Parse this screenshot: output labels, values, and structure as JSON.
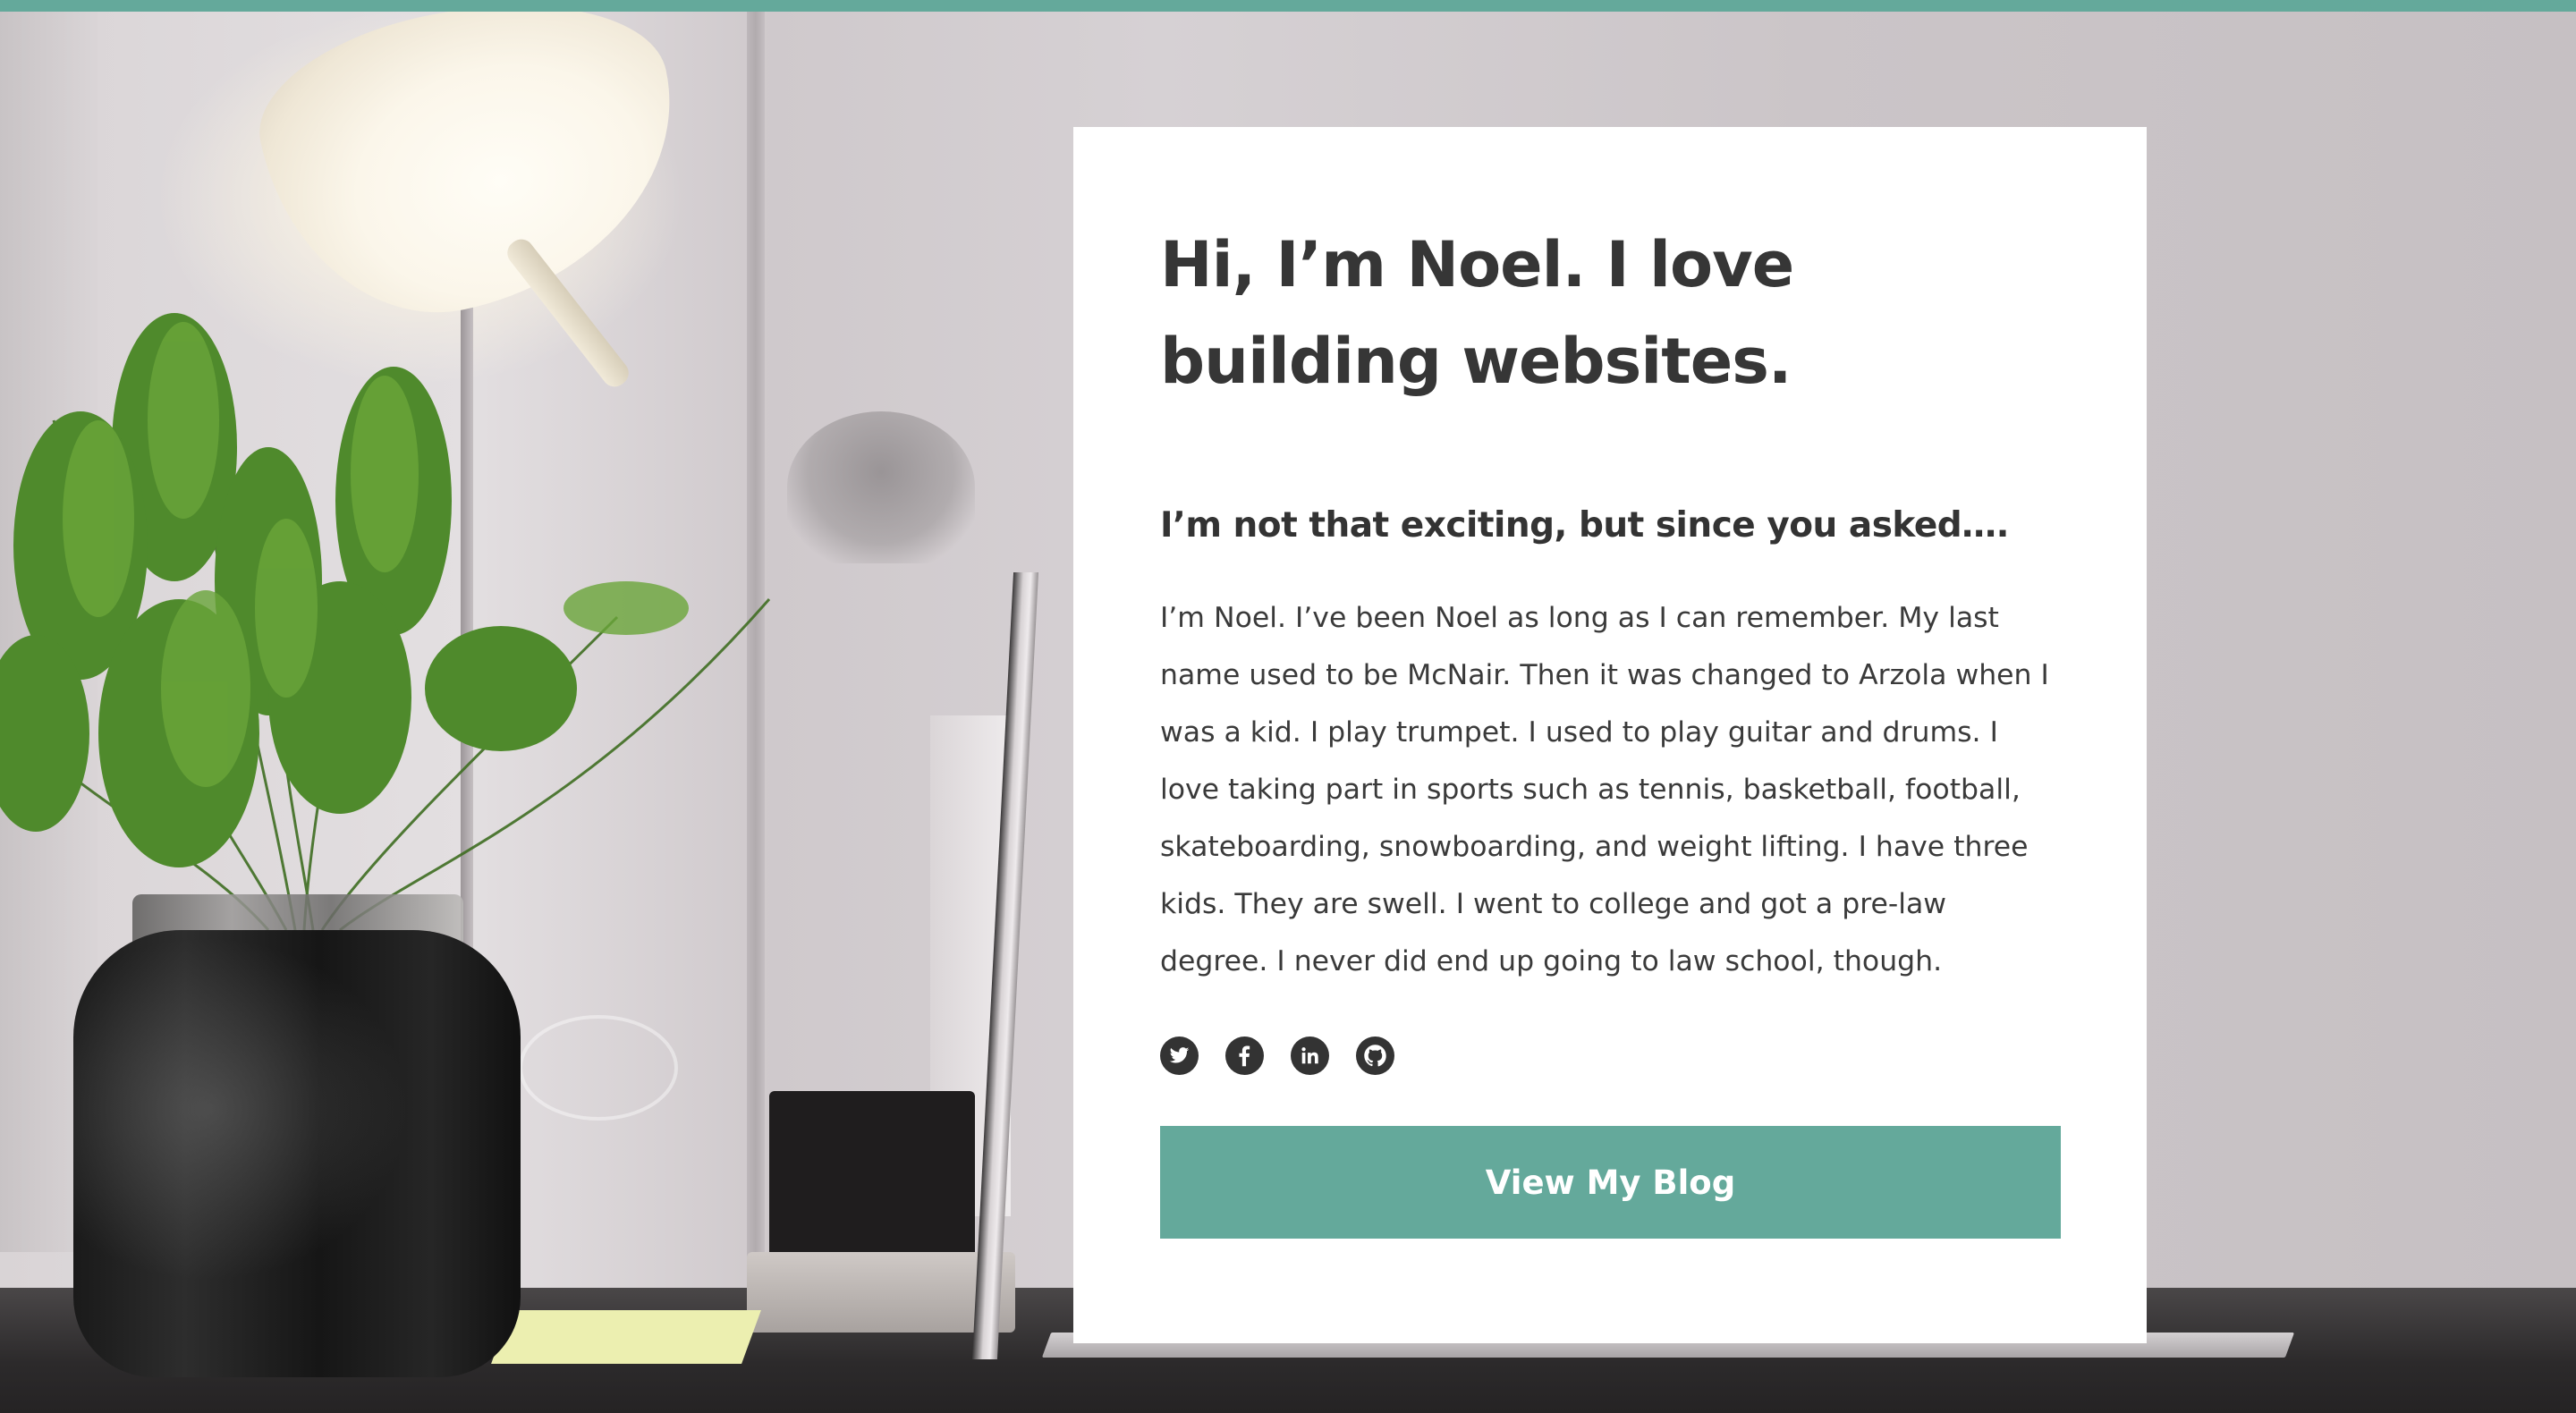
{
  "theme": {
    "accent": "#64a99b",
    "text_dark": "#363636",
    "card_bg": "#ffffff"
  },
  "card": {
    "headline": "Hi, I’m Noel. I love building websites.",
    "subhead": "I’m not that exciting, but since you asked….",
    "bio": "I’m Noel. I’ve been Noel as long as I can remember. My last name used to be McNair. Then it was changed to Arzola when I was a kid. I play trumpet. I used to play guitar and drums. I love taking part in sports such as tennis, basketball, football, skateboarding, snowboarding, and weight lifting. I have three kids. They are swell. I went to college and got a pre-law degree. I never did end up going to law school, though.",
    "social": [
      {
        "icon": "twitter-icon"
      },
      {
        "icon": "facebook-icon"
      },
      {
        "icon": "linkedin-icon"
      },
      {
        "icon": "github-icon"
      }
    ],
    "cta_label": "View My Blog"
  }
}
